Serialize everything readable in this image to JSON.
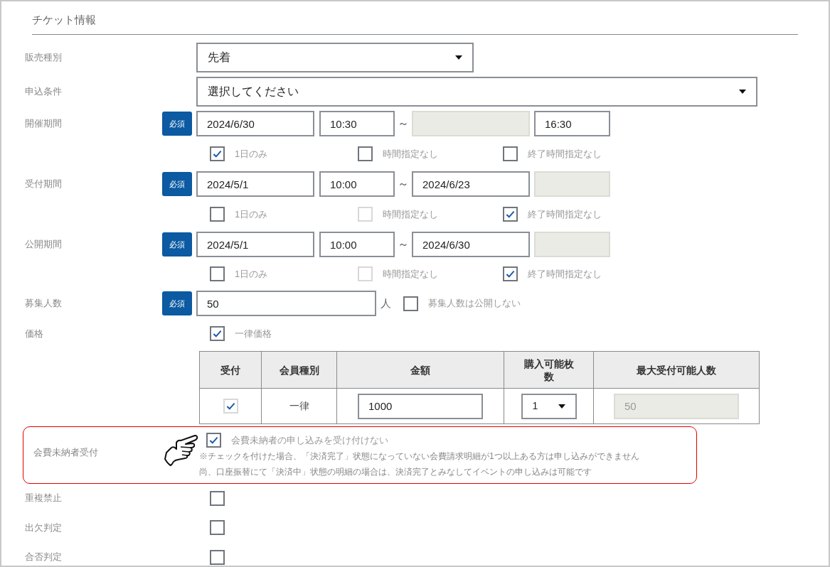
{
  "section_title": "チケット情報",
  "sales_type": {
    "label": "販売種別",
    "value": "先着"
  },
  "condition": {
    "label": "申込条件",
    "value": "選択してください"
  },
  "periods": [
    {
      "label": "開催期間",
      "required": "必須",
      "start_date": {
        "value": "2024/6/30",
        "disabled": false
      },
      "start_time": {
        "value": "10:30",
        "disabled": false
      },
      "separator": "～",
      "end_date": {
        "disabled": true
      },
      "end_time": {
        "value": "16:30",
        "disabled": false
      },
      "options": [
        {
          "label": "1日のみ",
          "checked": true,
          "disabled": false
        },
        {
          "label": "時間指定なし",
          "checked": false,
          "disabled": false
        },
        {
          "label": "終了時間指定なし",
          "checked": false,
          "disabled": false
        }
      ]
    },
    {
      "label": "受付期間",
      "required": "必須",
      "start_date": {
        "value": "2024/5/1",
        "disabled": false
      },
      "start_time": {
        "value": "10:00",
        "disabled": false
      },
      "separator": "～",
      "end_date": {
        "value": "2024/6/23",
        "disabled": false
      },
      "end_time": {
        "disabled": true
      },
      "options": [
        {
          "label": "1日のみ",
          "checked": false,
          "disabled": false
        },
        {
          "label": "時間指定なし",
          "checked": false,
          "disabled": true
        },
        {
          "label": "終了時間指定なし",
          "checked": true,
          "disabled": false
        }
      ]
    },
    {
      "label": "公開期間",
      "required": "必須",
      "start_date": {
        "value": "2024/5/1",
        "disabled": false
      },
      "start_time": {
        "value": "10:00",
        "disabled": false
      },
      "separator": "～",
      "end_date": {
        "value": "2024/6/30",
        "disabled": false
      },
      "end_time": {
        "disabled": true
      },
      "options": [
        {
          "label": "1日のみ",
          "checked": false,
          "disabled": false
        },
        {
          "label": "時間指定なし",
          "checked": false,
          "disabled": true
        },
        {
          "label": "終了時間指定なし",
          "checked": true,
          "disabled": false
        }
      ]
    }
  ],
  "capacity": {
    "label": "募集人数",
    "required": "必須",
    "value": "50",
    "unit": "人",
    "option": {
      "label": "募集人数は公開しない",
      "checked": false
    }
  },
  "price": {
    "label": "価格",
    "uniform": {
      "label": "一律価格",
      "checked": true
    },
    "table": {
      "columns": [
        "受付",
        "会員種別",
        "金額",
        "購入可能枚数",
        "最大受付可能人数"
      ],
      "rows": [
        {
          "accept": {
            "checked": true,
            "disabled": true
          },
          "member_type": "一律",
          "amount": "1000",
          "quantity": "1",
          "max": {
            "value": "50",
            "disabled": true
          }
        }
      ]
    }
  },
  "unpaid": {
    "label": "会費未納者受付",
    "highlighted": true,
    "option": {
      "label": "会費未納者の申し込みを受け付けない",
      "checked": true
    },
    "notes": [
      "※チェックを付けた場合、「決済完了」状態になっていない会費請求明細が1つ以上ある方は申し込みができません",
      "尚、口座振替にて「決済中」状態の明細の場合は、決済完了とみなしてイベントの申し込みは可能です"
    ]
  },
  "flags": [
    {
      "label": "重複禁止",
      "checked": false
    },
    {
      "label": "出欠判定",
      "checked": false
    },
    {
      "label": "合否判定",
      "checked": false
    }
  ]
}
